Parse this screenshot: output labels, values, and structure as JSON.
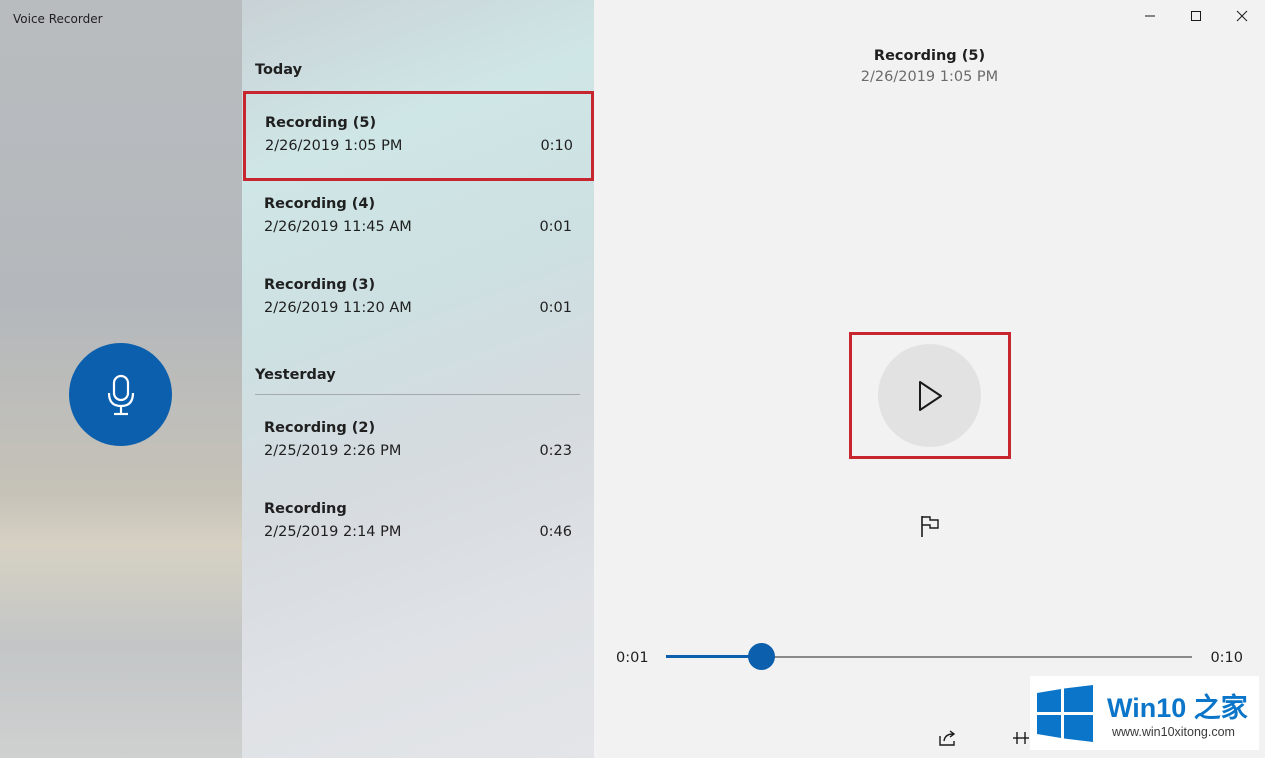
{
  "app": {
    "title": "Voice Recorder"
  },
  "colors": {
    "accent": "#0b5fad",
    "highlight": "#c8262e",
    "brand": "#0b76c9"
  },
  "groups": {
    "today": {
      "label": "Today",
      "items": [
        {
          "name": "Recording (5)",
          "date": "2/26/2019 1:05 PM",
          "duration": "0:10",
          "selected": true
        },
        {
          "name": "Recording (4)",
          "date": "2/26/2019 11:45 AM",
          "duration": "0:01"
        },
        {
          "name": "Recording (3)",
          "date": "2/26/2019 11:20 AM",
          "duration": "0:01"
        }
      ]
    },
    "yesterday": {
      "label": "Yesterday",
      "items": [
        {
          "name": "Recording (2)",
          "date": "2/25/2019 2:26 PM",
          "duration": "0:23"
        },
        {
          "name": "Recording",
          "date": "2/25/2019 2:14 PM",
          "duration": "0:46"
        }
      ]
    }
  },
  "player": {
    "title": "Recording (5)",
    "date": "2/26/2019 1:05 PM",
    "elapsed": "0:01",
    "total": "0:10",
    "progress": 0.18
  },
  "icons": {
    "record": "microphone-icon",
    "play": "play-icon",
    "marker": "flag-icon",
    "share": "share-icon",
    "trim": "trim-icon",
    "minimize": "minimize-icon",
    "maximize": "maximize-icon",
    "close": "close-icon"
  },
  "watermark": {
    "brand": "Win10 之家",
    "url": "www.win10xitong.com"
  }
}
